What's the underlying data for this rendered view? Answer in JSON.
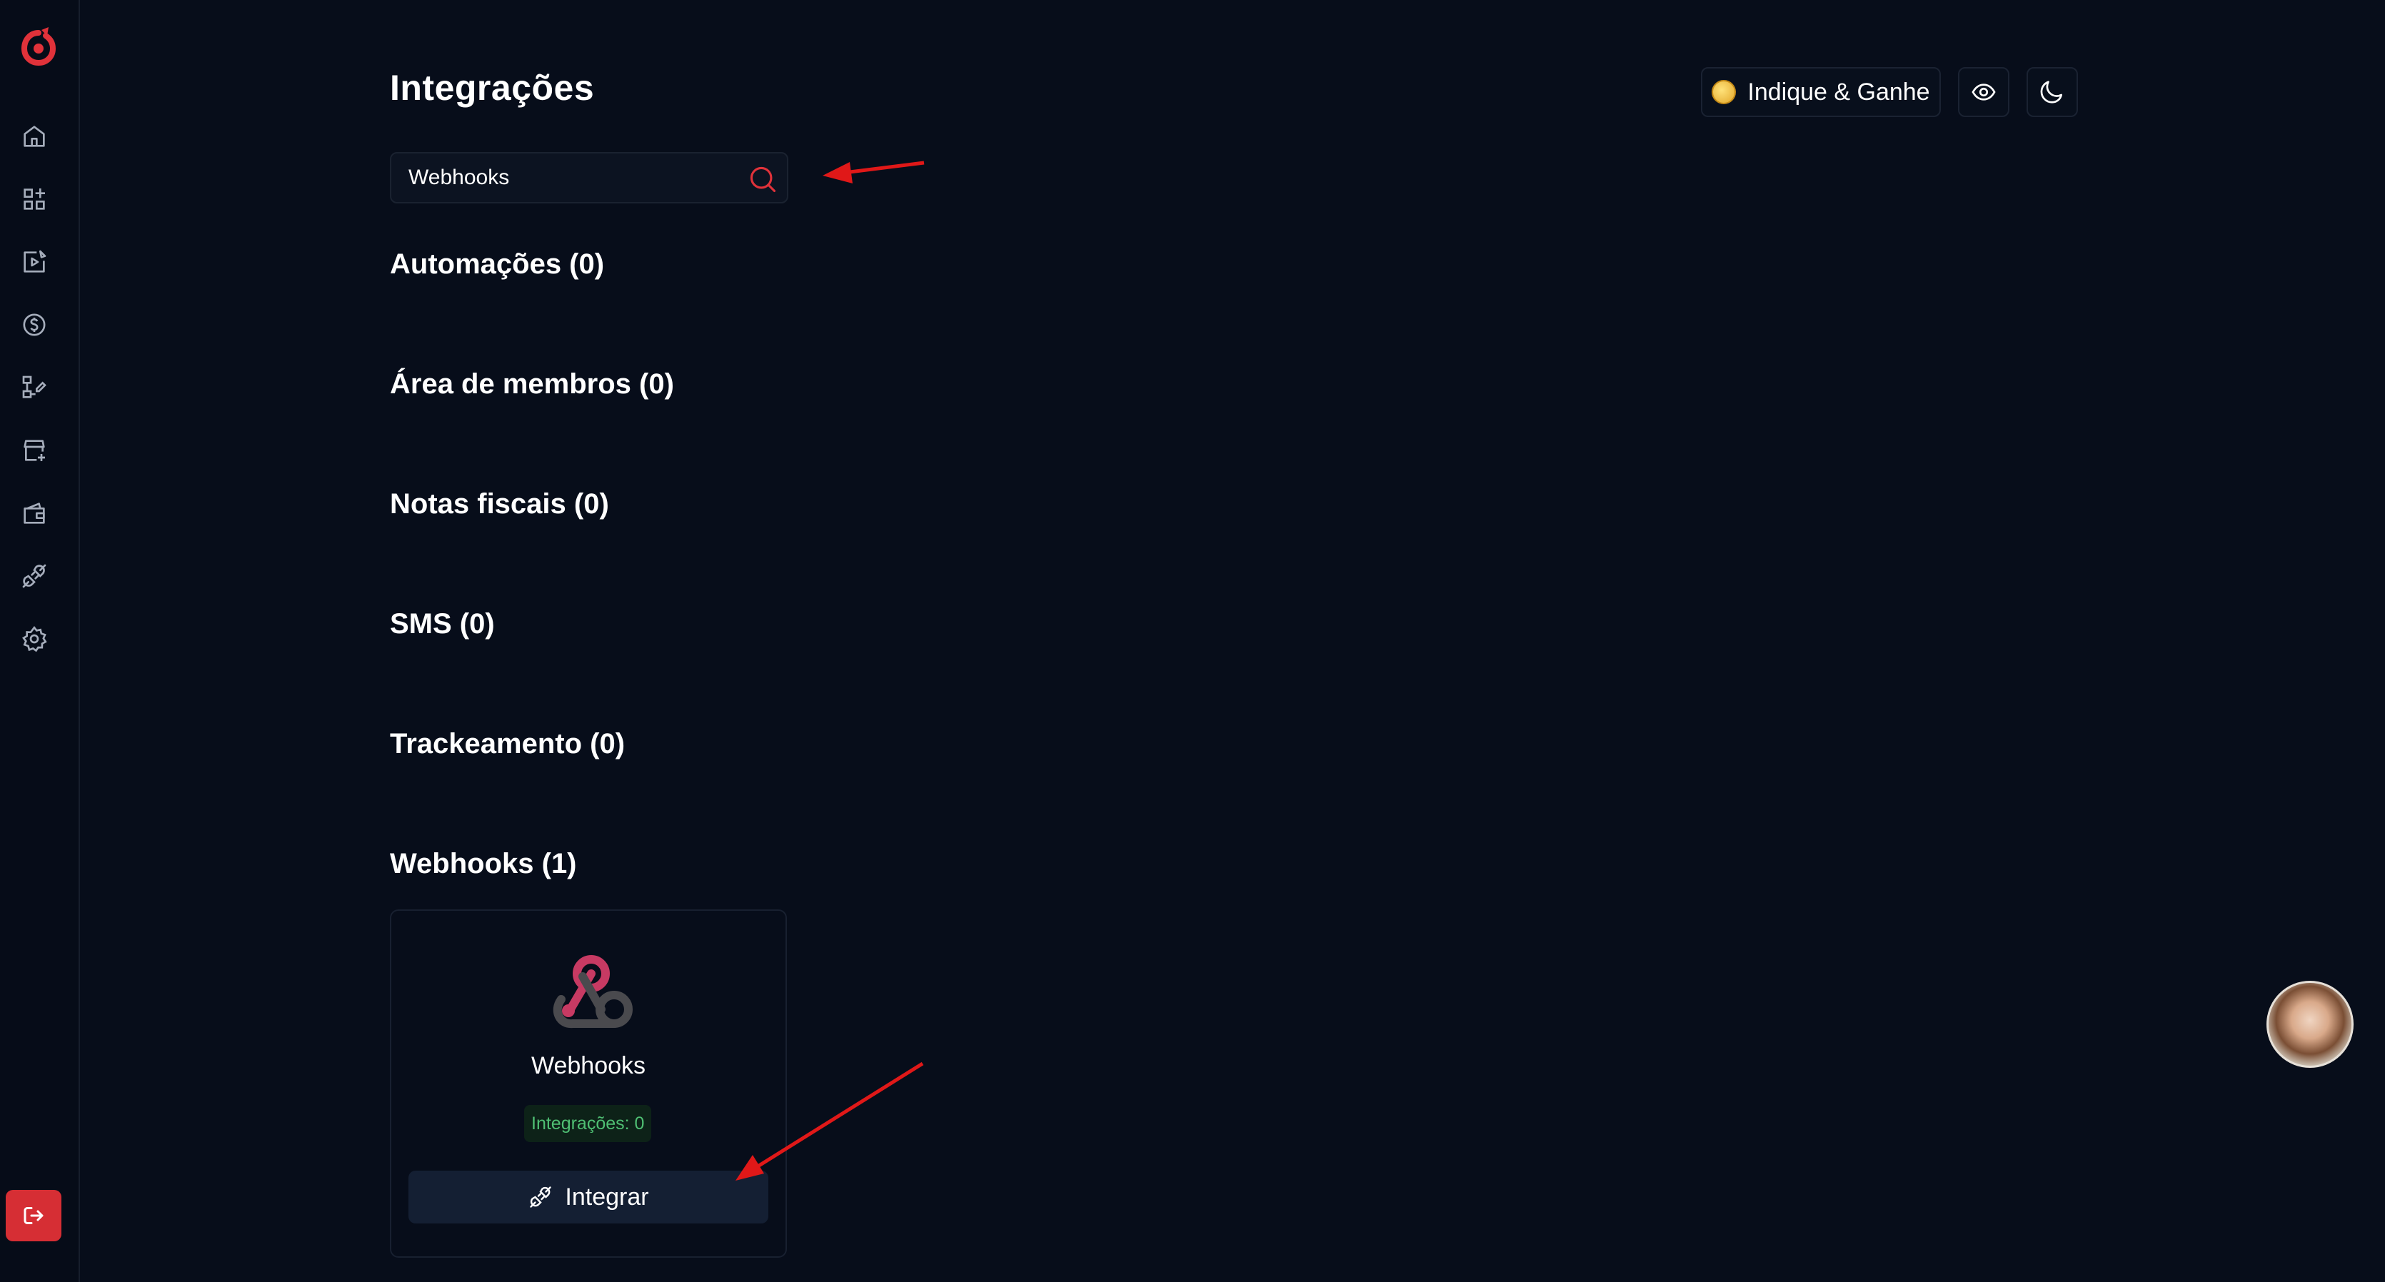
{
  "page": {
    "title": "Integrações"
  },
  "search": {
    "value": "Webhooks"
  },
  "sections": [
    {
      "label": "Automações (0)"
    },
    {
      "label": "Área de membros (0)"
    },
    {
      "label": "Notas fiscais (0)"
    },
    {
      "label": "SMS (0)"
    },
    {
      "label": "Trackeamento (0)"
    },
    {
      "label": "Webhooks (1)"
    }
  ],
  "card": {
    "name": "Webhooks",
    "badge": "Integrações: 0",
    "button_label": "Integrar"
  },
  "header": {
    "referral_label": "Indique & Ganhe"
  },
  "sidebar": {
    "items": [
      {
        "icon": "home-icon"
      },
      {
        "icon": "apps-icon"
      },
      {
        "icon": "video-edit-icon"
      },
      {
        "icon": "dollar-icon"
      },
      {
        "icon": "workflow-icon"
      },
      {
        "icon": "store-icon"
      },
      {
        "icon": "wallet-icon"
      },
      {
        "icon": "plug-icon"
      },
      {
        "icon": "gear-icon"
      }
    ],
    "logout_icon": "logout-icon"
  },
  "colors": {
    "background": "#070d1a",
    "accent_red": "#d62e34",
    "badge_green": "#4fbf73",
    "button_bg": "#141f33"
  }
}
